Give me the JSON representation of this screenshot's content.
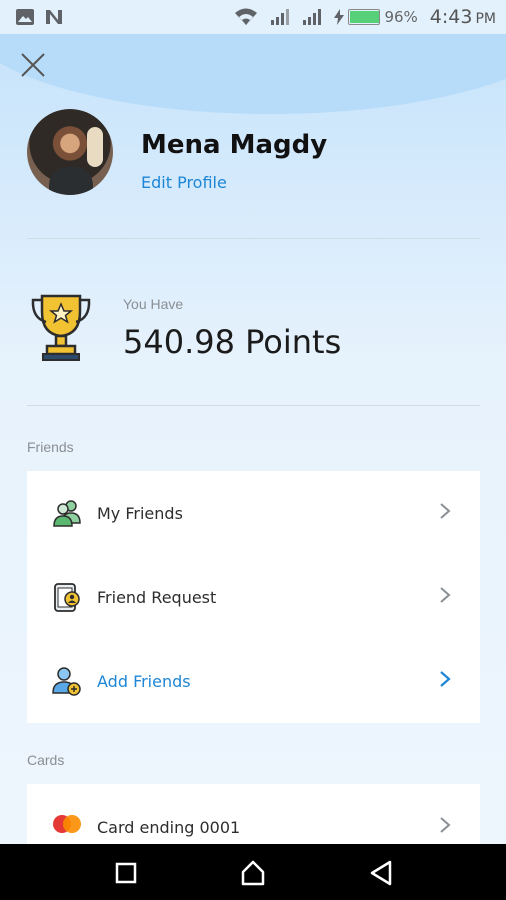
{
  "status_bar": {
    "battery_percent": "96%",
    "time": "4:43",
    "ampm": "PM",
    "icons": [
      "image-icon",
      "n-app-icon",
      "wifi-icon",
      "signal-icon",
      "signal-icon",
      "charging-icon",
      "battery-icon"
    ]
  },
  "profile": {
    "name": "Mena Magdy",
    "edit_label": "Edit Profile"
  },
  "points": {
    "caption": "You Have",
    "value": "540.98 Points"
  },
  "friends": {
    "section_title": "Friends",
    "items": [
      {
        "label": "My Friends"
      },
      {
        "label": "Friend Request"
      },
      {
        "label": "Add Friends"
      }
    ]
  },
  "cards": {
    "section_title": "Cards",
    "items": [
      {
        "label": "Card ending 0001"
      }
    ]
  },
  "colors": {
    "accent": "#1d86d6",
    "trophy": "#f1c232"
  }
}
